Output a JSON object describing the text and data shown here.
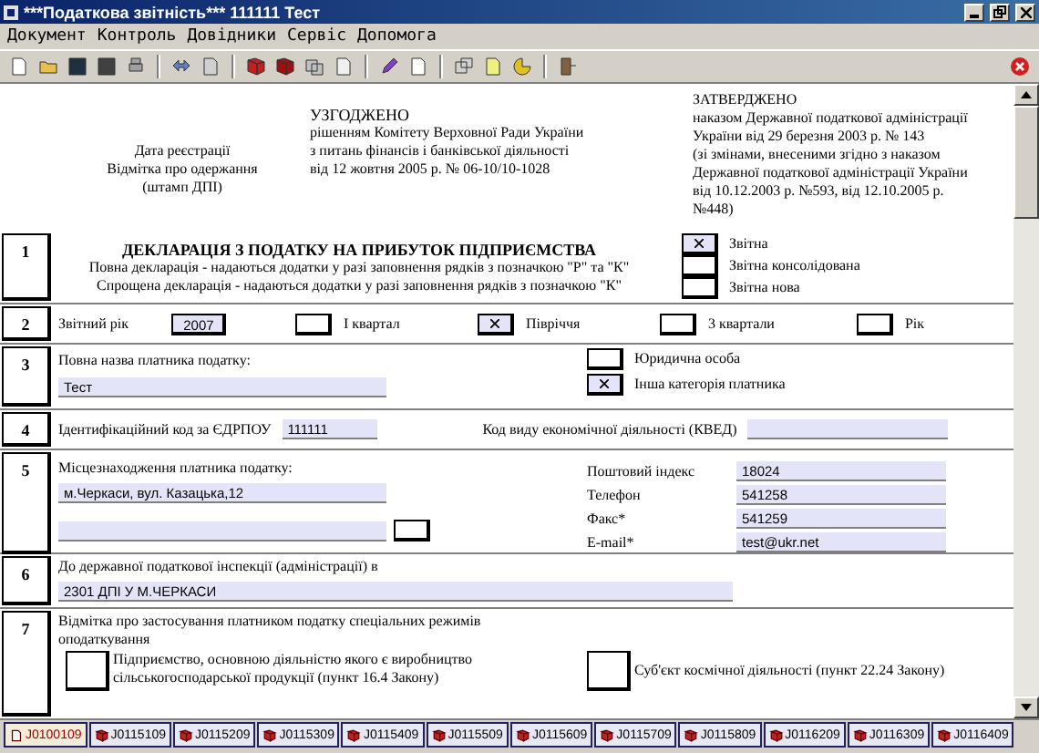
{
  "window": {
    "title": "***Податкова звітність*** 111111 Тест"
  },
  "menu": [
    "Документ",
    "Контроль",
    "Довідники",
    "Сервіс",
    "Допомога"
  ],
  "header": {
    "registration": [
      "Дата реєстрації",
      "Відмітка про одержання",
      "(штамп ДПІ)"
    ],
    "agreed": {
      "title": "УЗГОДЖЕНО",
      "lines": [
        "рішенням Комітету Верховної Ради України",
        "з питань фінансів і банківської діяльності",
        "від 12 жовтня 2005 р. № 06-10/10-1028"
      ]
    },
    "approved": {
      "title": "ЗАТВЕРДЖЕНО",
      "lines": [
        "наказом Державної податкової адміністрації",
        "України від 29 березня 2003 р. № 143",
        "(зі змінами, внесеними згідно з наказом",
        "Державної податкової адміністрації України",
        "від 10.12.2003 р. №593, від 12.10.2005 р.",
        "№448)"
      ]
    }
  },
  "section_1": {
    "number": "1",
    "title": "ДЕКЛАРАЦІЯ З ПОДАТКУ НА ПРИБУТОК ПІДПРИЄМСТВА",
    "lines": [
      "Повна декларація - надаються додатки у разі заповнення рядків з позначкою \"Р\" та \"К\"",
      "Спрощена декларація - надаються додатки у разі заповнення рядків з позначкою \"К\""
    ],
    "options": [
      {
        "label": "Звітна",
        "checked": true
      },
      {
        "label": "Звітна консолідована",
        "checked": false
      },
      {
        "label": "Звітна нова",
        "checked": false
      }
    ]
  },
  "section_2": {
    "number": "2",
    "label": "Звітний рік",
    "year": "2007",
    "options": [
      {
        "label": "I квартал",
        "checked": false
      },
      {
        "label": "Півріччя",
        "checked": true
      },
      {
        "label": "3 квартали",
        "checked": false
      },
      {
        "label": "Рік",
        "checked": false
      }
    ]
  },
  "section_3": {
    "number": "3",
    "label": "Повна назва платника податку:",
    "value": "Тест",
    "options": [
      {
        "label": "Юридична особа",
        "checked": false
      },
      {
        "label": "Інша категорія платника",
        "checked": true
      }
    ]
  },
  "section_4": {
    "number": "4",
    "code_label": "Ідентифікаційний код за ЄДРПОУ",
    "code": "111111",
    "kved_label": "Код виду економічної діяльності (КВЕД)"
  },
  "section_5": {
    "number": "5",
    "label": "Місцезнаходження платника податку:",
    "address": "м.Черкаси, вул. Казацька,12",
    "contacts": [
      {
        "label": "Поштовий індекс",
        "value": "18024"
      },
      {
        "label": "Телефон",
        "value": "541258"
      },
      {
        "label": "Факс*",
        "value": "541259"
      },
      {
        "label": "E-mail*",
        "value": "test@ukr.net"
      }
    ]
  },
  "section_6": {
    "number": "6",
    "label": "До державної податкової інспекції (адміністрації) в",
    "value": "2301 ДПІ У М.ЧЕРКАСИ"
  },
  "section_7": {
    "number": "7",
    "label": "Відмітка про застосування платником податку спеціальних режимів оподаткування",
    "options": [
      {
        "label": "Підприємство, основною діяльністю якого є виробництво сільськогосподарської продукції (пункт 16.4 Закону)",
        "checked": false
      },
      {
        "label": "Суб'єкт космічної діяльності (пункт 22.24 Закону)",
        "checked": false
      }
    ]
  },
  "tabs": [
    {
      "label": "J0100109",
      "selected": true
    },
    {
      "label": "J0115109",
      "selected": false
    },
    {
      "label": "J0115209",
      "selected": false
    },
    {
      "label": "J0115309",
      "selected": false
    },
    {
      "label": "J0115409",
      "selected": false
    },
    {
      "label": "J0115509",
      "selected": false
    },
    {
      "label": "J0115609",
      "selected": false
    },
    {
      "label": "J0115709",
      "selected": false
    },
    {
      "label": "J0115809",
      "selected": false
    },
    {
      "label": "J0116209",
      "selected": false
    },
    {
      "label": "J0116309",
      "selected": false
    },
    {
      "label": "J0116409",
      "selected": false
    }
  ]
}
